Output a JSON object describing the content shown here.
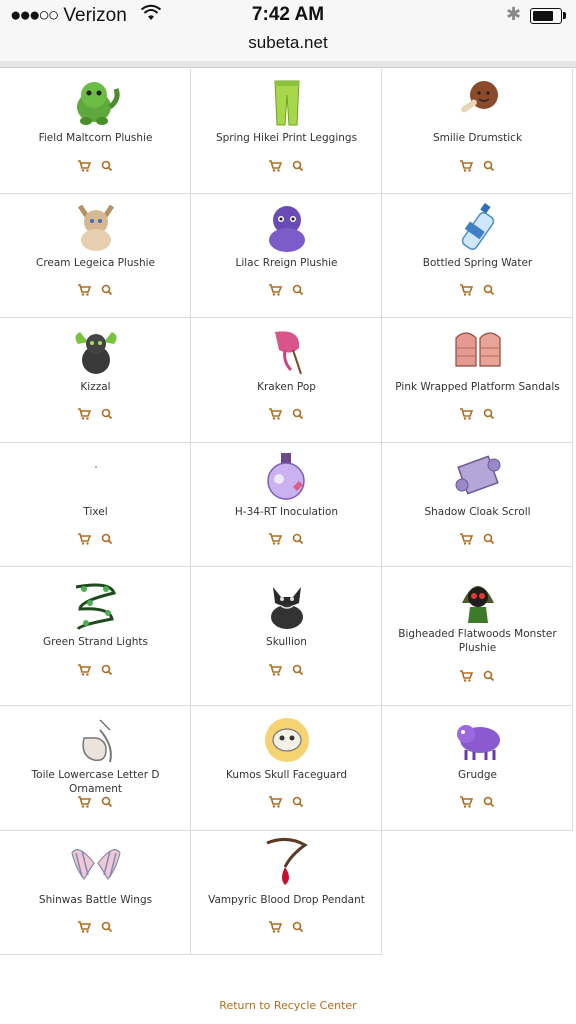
{
  "status": {
    "carrier": "Verizon",
    "time": "7:42 AM"
  },
  "browser": {
    "url": "subeta.net"
  },
  "items": [
    {
      "name": "Field Maltcorn Plushie"
    },
    {
      "name": "Spring Hikei Print Leggings"
    },
    {
      "name": "Smilie Drumstick"
    },
    {
      "name": "Cream Legeica Plushie"
    },
    {
      "name": "Lilac Rreign Plushie"
    },
    {
      "name": "Bottled Spring Water"
    },
    {
      "name": "Kizzal"
    },
    {
      "name": "Kraken Pop"
    },
    {
      "name": "Pink Wrapped Platform Sandals"
    },
    {
      "name": "Tixel"
    },
    {
      "name": "H-34-RT Inoculation"
    },
    {
      "name": "Shadow Cloak Scroll"
    },
    {
      "name": "Green Strand Lights"
    },
    {
      "name": "Skullion"
    },
    {
      "name": "Bigheaded Flatwoods Monster Plushie"
    },
    {
      "name": "Toile Lowercase Letter D Ornament"
    },
    {
      "name": "Kumos Skull Faceguard"
    },
    {
      "name": "Grudge"
    },
    {
      "name": "Shinwas Battle Wings"
    },
    {
      "name": "Vampyric Blood Drop Pendant"
    }
  ],
  "footer": {
    "link": "Return to Recycle Center"
  },
  "colors": {
    "accent": "#b06d1e",
    "border": "#dcdcdc"
  }
}
